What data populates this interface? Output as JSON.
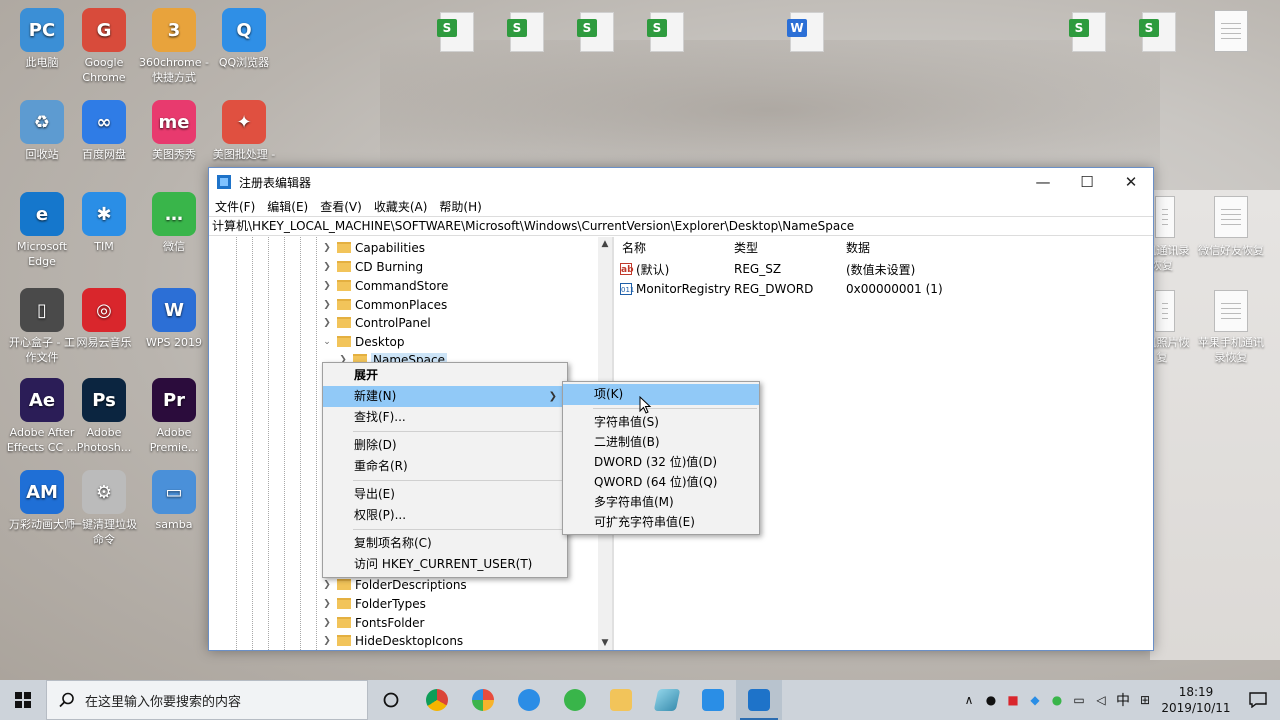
{
  "desktop": {
    "icons": [
      {
        "label": "此电脑",
        "color": "#3b8fd6",
        "glyph": "PC"
      },
      {
        "label": "Google Chrome",
        "color": "#d84b3b",
        "glyph": "G"
      },
      {
        "label": "360chrome - 快捷方式",
        "color": "#e8a33c",
        "glyph": "3"
      },
      {
        "label": "QQ浏览器",
        "color": "#2f8fe6",
        "glyph": "Q"
      },
      {
        "label": "回收站",
        "color": "#5d9bd1",
        "glyph": "♻"
      },
      {
        "label": "百度网盘",
        "color": "#2f7ce6",
        "glyph": "∞"
      },
      {
        "label": "美图秀秀",
        "color": "#e83a6e",
        "glyph": "me"
      },
      {
        "label": "美图批处理 -",
        "color": "#e05040",
        "glyph": "✦"
      },
      {
        "label": "Microsoft Edge",
        "color": "#1577cc",
        "glyph": "e"
      },
      {
        "label": "TIM",
        "color": "#2a8ee6",
        "glyph": "✱"
      },
      {
        "label": "微信",
        "color": "#39b54a",
        "glyph": "…"
      },
      {
        "label": "开心盒子 - 工作文件",
        "color": "#4a4a4a",
        "glyph": "▯"
      },
      {
        "label": "网易云音乐",
        "color": "#d9262c",
        "glyph": "◎"
      },
      {
        "label": "WPS 2019",
        "color": "#2c6fd6",
        "glyph": "W"
      },
      {
        "label": "Adobe After Effects CC ...",
        "color": "#2b1d57",
        "glyph": "Ae"
      },
      {
        "label": "Adobe Photosh...",
        "color": "#0b2540",
        "glyph": "Ps"
      },
      {
        "label": "Adobe Premie...",
        "color": "#2b0c3c",
        "glyph": "Pr"
      },
      {
        "label": "万彩动画大师",
        "color": "#1f6fd6",
        "glyph": "AM"
      },
      {
        "label": "一键清理垃圾命令",
        "color": "#bbbbbb",
        "glyph": "⚙"
      },
      {
        "label": "samba",
        "color": "#4a90d9",
        "glyph": "▭"
      }
    ],
    "right_texts": [
      "手机通讯录恢复",
      "微信好友恢复",
      "手机照片恢复",
      "苹果手机通讯录恢复"
    ]
  },
  "window": {
    "title": "注册表编辑器",
    "menu": [
      "文件(F)",
      "编辑(E)",
      "查看(V)",
      "收藏夹(A)",
      "帮助(H)"
    ],
    "address": "计算机\\HKEY_LOCAL_MACHINE\\SOFTWARE\\Microsoft\\Windows\\CurrentVersion\\Explorer\\Desktop\\NameSpace",
    "minimize": "—",
    "maximize": "☐",
    "close": "✕",
    "tree_top": [
      "Capabilities",
      "CD Burning",
      "CommandStore",
      "CommonPlaces",
      "ControlPanel",
      "Desktop",
      "NameSpace"
    ],
    "tree_bottom": [
      "FolderDescriptions",
      "FolderTypes",
      "FontsFolder",
      "HideDesktopIcons"
    ],
    "columns": {
      "name": "名称",
      "type": "类型",
      "data": "数据"
    },
    "values": [
      {
        "name": "(默认)",
        "type": "REG_SZ",
        "data": "(数值未设置)",
        "icon": "ab"
      },
      {
        "name": "MonitorRegistry",
        "type": "REG_DWORD",
        "data": "0x00000001 (1)",
        "icon": "011"
      }
    ]
  },
  "context_menu": {
    "items": [
      "展开",
      "新建(N)",
      "查找(F)...",
      "删除(D)",
      "重命名(R)",
      "导出(E)",
      "权限(P)...",
      "复制项名称(C)",
      "访问 HKEY_CURRENT_USER(T)"
    ]
  },
  "submenu": {
    "items": [
      "项(K)",
      "字符串值(S)",
      "二进制值(B)",
      "DWORD (32 位)值(D)",
      "QWORD (64 位)值(Q)",
      "多字符串值(M)",
      "可扩充字符串值(E)"
    ]
  },
  "taskbar": {
    "search_placeholder": "在这里输入你要搜索的内容",
    "ime_label": "中",
    "time": "18:19",
    "date": "2019/10/11"
  }
}
